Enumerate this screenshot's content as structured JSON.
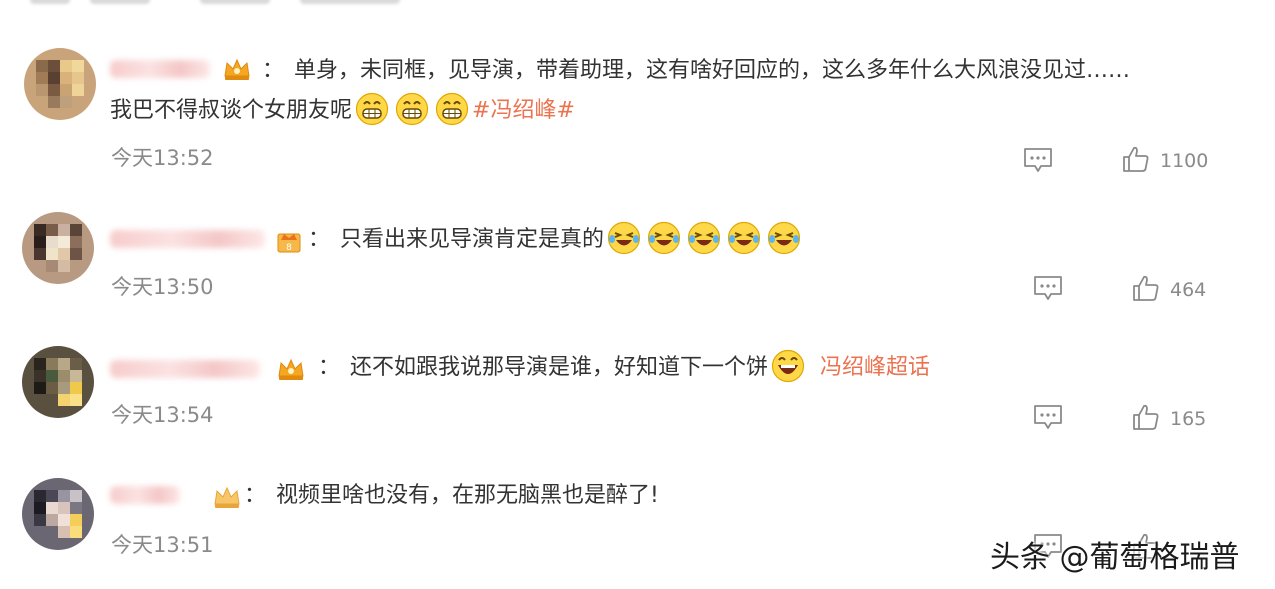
{
  "comments": [
    {
      "text_line1": "单身，未同框，见导演，带着助理，这有啥好回应的，这么多年什么大风浪没见过……",
      "text_line2": "我巴不得叔谈个女朋友呢",
      "tag": "#冯绍峰#",
      "time": "今天13:52",
      "likes": "1100",
      "colon": "：",
      "emoji": "grin-emoji"
    },
    {
      "text_line1": "只看出来见导演肯定是真的",
      "time": "今天13:50",
      "likes": "464",
      "colon": "：",
      "emoji": "laugh-cry-emoji"
    },
    {
      "text_line1": "还不如跟我说那导演是谁，好知道下一个饼",
      "tag": "冯绍峰超话",
      "time": "今天13:54",
      "likes": "165",
      "colon": "：",
      "emoji": "laughing-emoji"
    },
    {
      "text_line1": "视频里啥也没有，在那无脑黑也是醉了!",
      "time": "今天13:51",
      "likes": "",
      "colon": "："
    }
  ],
  "watermark": "头条 @葡萄格瑞普",
  "colors": {
    "tag": "#eb7350",
    "meta": "#8a8a8a",
    "text": "#333333"
  }
}
